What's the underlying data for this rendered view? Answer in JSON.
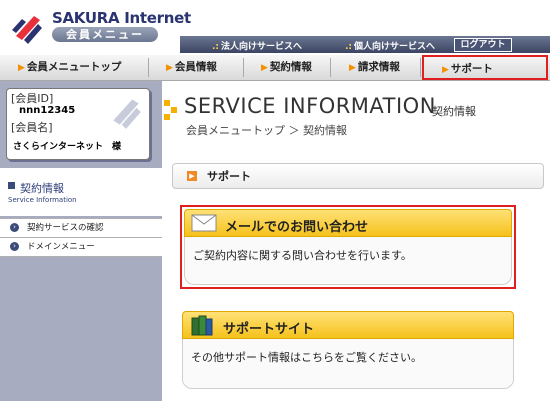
{
  "header": {
    "brand": "SAKURA Internet",
    "badge": "会員メニュー",
    "top_links": [
      "法人向けサービスへ",
      "個人向けサービスへ"
    ],
    "logout": "ログアウト"
  },
  "nav": {
    "tabs": [
      {
        "label": "会員メニュートップ",
        "active": false
      },
      {
        "label": "会員情報",
        "active": false
      },
      {
        "label": "契約情報",
        "active": false
      },
      {
        "label": "請求情報",
        "active": false
      },
      {
        "label": "サポート",
        "active": true
      }
    ]
  },
  "sidebar": {
    "member_id_label": "[会員ID]",
    "member_id": "nnn12345",
    "member_name_label": "[会員名]",
    "member_name": "さくらインターネット　様",
    "section_title": "契約情報",
    "section_subtitle": "Service Information",
    "items": [
      "契約サービスの確認",
      "ドメインメニュー"
    ]
  },
  "main": {
    "title": "SERVICE INFORMATION",
    "subtitle": "契約情報",
    "breadcrumb": "会員メニュートップ ＞ 契約情報",
    "section": "サポート",
    "cards": [
      {
        "title": "メールでのお問い合わせ",
        "body": "ご契約内容に関する問い合わせを行います。",
        "icon": "envelope-icon"
      },
      {
        "title": "サポートサイト",
        "body": "その他サポート情報はこちらをご覧ください。",
        "icon": "books-icon"
      }
    ]
  },
  "colors": {
    "accent_red": "#e02020",
    "nav_orange": "#f29100",
    "card_yellow": "#f5c21c",
    "sidebar_bg": "#a7acc0"
  }
}
